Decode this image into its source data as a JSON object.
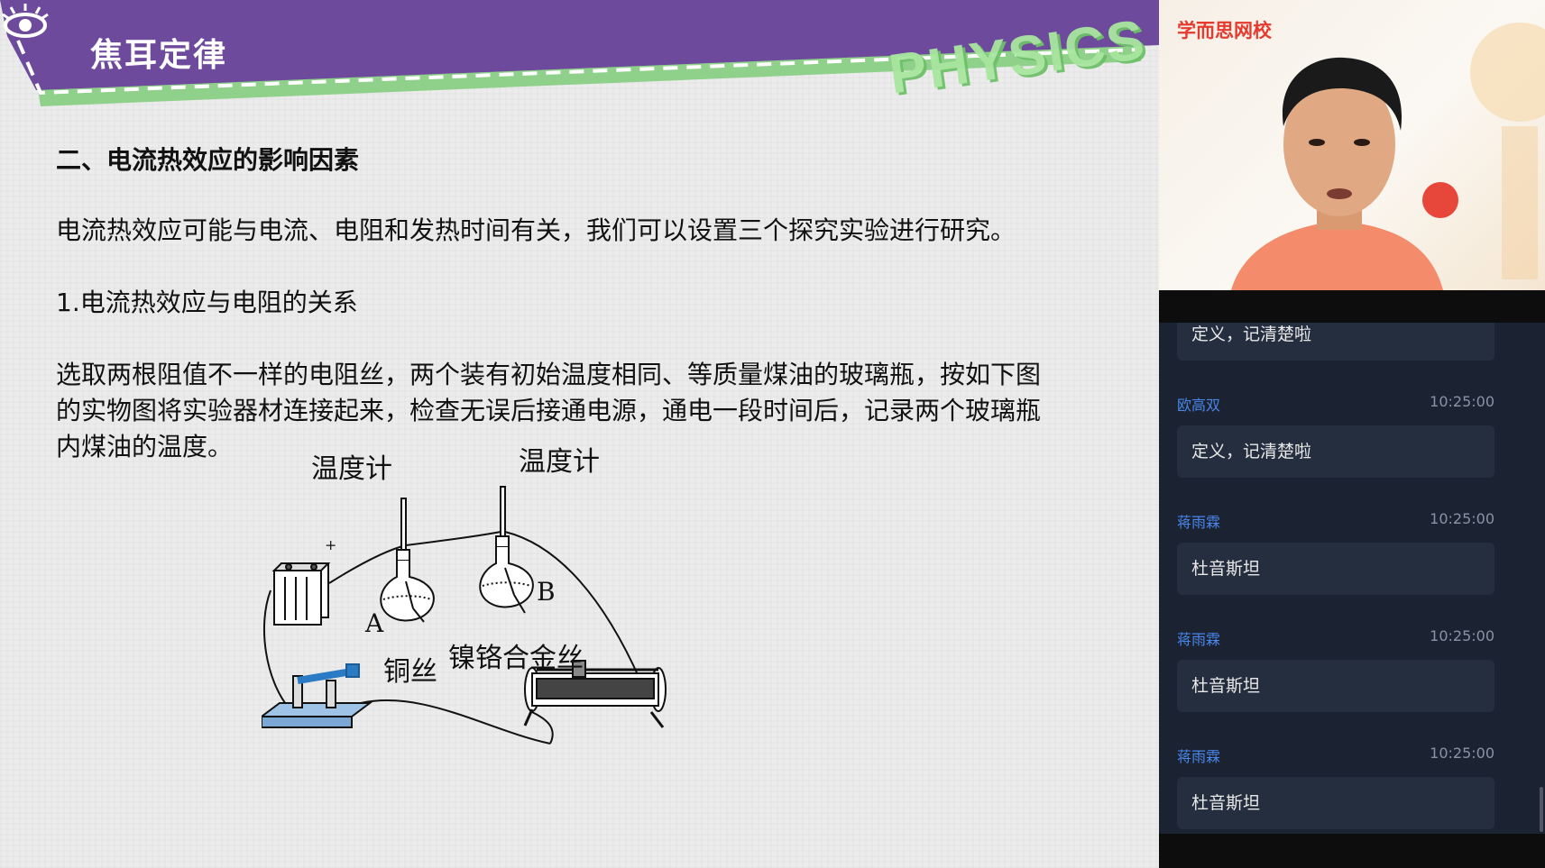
{
  "slide": {
    "banner_title": "焦耳定律",
    "logo_text": "PHYSICS",
    "heading": "二、电流热效应的影响因素",
    "paragraph1": "电流热效应可能与电流、电阻和发热时间有关，我们可以设置三个探究实验进行研究。",
    "paragraph2": "1.电流热效应与电阻的关系",
    "paragraph3_lines": [
      "选取两根阻值不一样的电阻丝，两个装有初始温度相同、等质量煤油的玻璃瓶，按如下图",
      "的实物图将实验器材连接起来，检查无误后接通电源，通电一段时间后，记录两个玻璃瓶",
      "内煤油的温度。"
    ],
    "diagram": {
      "thermometer_left": "温度计",
      "thermometer_right": "温度计",
      "label_a": "A",
      "label_b": "B",
      "wire_a": "铜丝",
      "wire_b": "镍铬合金丝",
      "plus_sign": "+"
    }
  },
  "video": {
    "brand": "学而思网校"
  },
  "chat": {
    "top_partial_message": "定义，记清楚啦",
    "messages": [
      {
        "user": "欧高双",
        "time": "10:25:00",
        "text": "定义，记清楚啦"
      },
      {
        "user": "蒋雨霖",
        "time": "10:25:00",
        "text": "杜音斯坦"
      },
      {
        "user": "蒋雨霖",
        "time": "10:25:00",
        "text": "杜音斯坦"
      },
      {
        "user": "蒋雨霖",
        "time": "10:25:00",
        "text": "杜音斯坦"
      }
    ]
  },
  "colors": {
    "banner_purple": "#6d4a9c",
    "banner_green": "#8fd18a",
    "brand_red": "#e43b2e",
    "chat_bg": "#1b2333",
    "username_blue": "#4a86e8"
  }
}
